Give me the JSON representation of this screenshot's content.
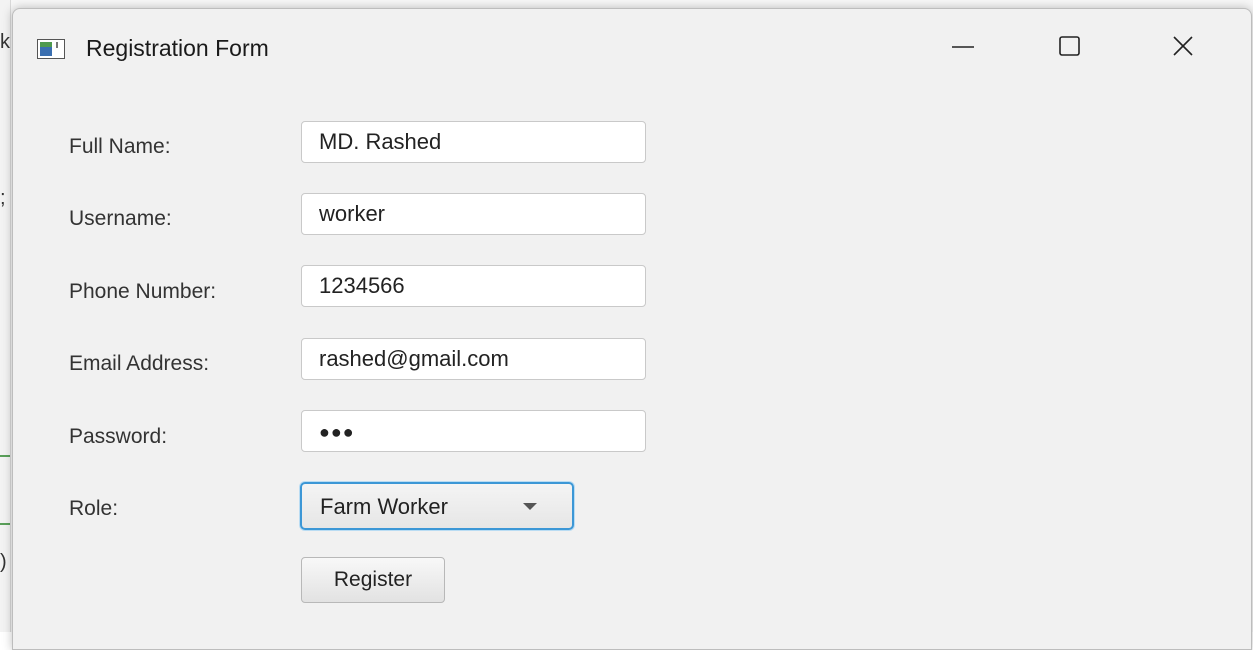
{
  "window": {
    "title": "Registration Form"
  },
  "controls": {
    "minimize_icon": "minimize-icon",
    "maximize_icon": "maximize-icon",
    "close_icon": "close-icon"
  },
  "form": {
    "full_name": {
      "label": "Full Name:",
      "value": "MD. Rashed"
    },
    "username": {
      "label": "Username:",
      "value": "worker"
    },
    "phone": {
      "label": "Phone Number:",
      "value": "1234566"
    },
    "email": {
      "label": "Email Address:",
      "value": "rashed@gmail.com"
    },
    "password": {
      "label": "Password:",
      "masked_value": "●●●"
    },
    "role": {
      "label": "Role:",
      "selected": "Farm Worker"
    },
    "submit_label": "Register"
  },
  "colors": {
    "window_bg": "#f1f1f1",
    "focus_accent": "#3c97d6"
  }
}
